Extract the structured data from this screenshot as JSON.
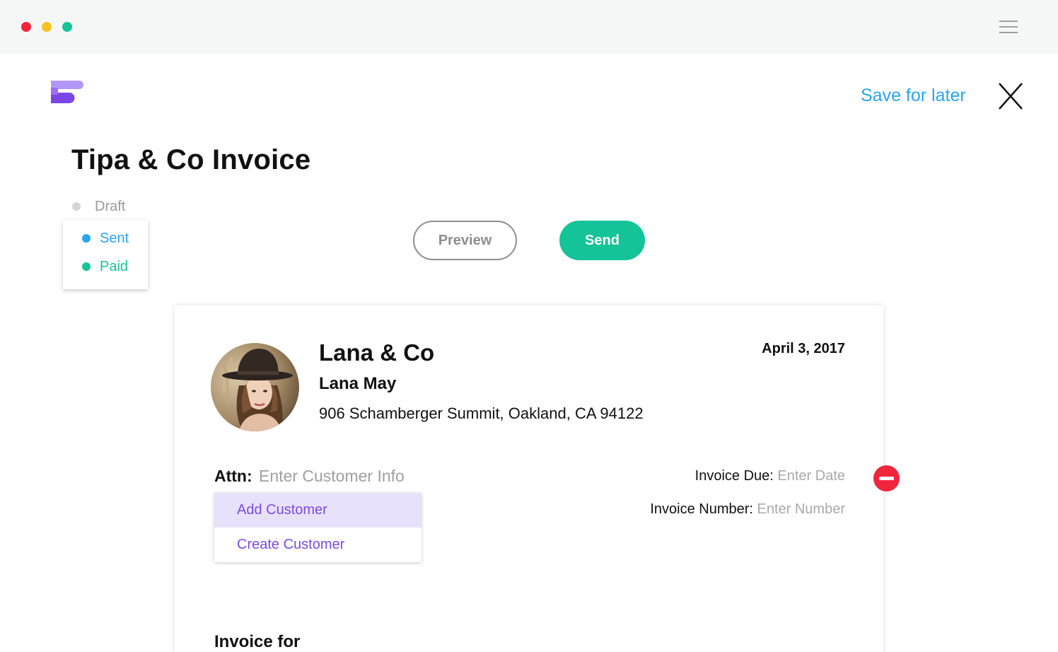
{
  "window": {
    "controls": [
      "close",
      "minimize",
      "maximize"
    ],
    "menu_icon": "hamburger-icon"
  },
  "header": {
    "logo_icon": "app-logo-icon",
    "save_label": "Save for later",
    "close_icon": "close-icon"
  },
  "page": {
    "title": "Tipa & Co Invoice"
  },
  "status": {
    "current": "Draft",
    "options": [
      {
        "label": "Sent",
        "color": "#2ba3ef"
      },
      {
        "label": "Paid",
        "color": "#14c397"
      }
    ]
  },
  "actions": {
    "preview_label": "Preview",
    "send_label": "Send"
  },
  "invoice": {
    "company": "Lana & Co",
    "contact": "Lana May",
    "address": "906 Schamberger Summit, Oakland, CA 94122",
    "date": "April 3, 2017",
    "attn_label": "Attn:",
    "attn_placeholder": "Enter Customer Info",
    "customer_menu": [
      "Add Customer",
      "Create Customer"
    ],
    "due_label": "Invoice Due:",
    "due_placeholder": "Enter Date",
    "number_label": "Invoice Number:",
    "number_placeholder": "Enter Number",
    "section_title": "Invoice for"
  },
  "colors": {
    "accent_blue": "#2ba3ef",
    "accent_green": "#14c397",
    "accent_purple": "#7b4cd9",
    "danger_red": "#f0263d"
  }
}
